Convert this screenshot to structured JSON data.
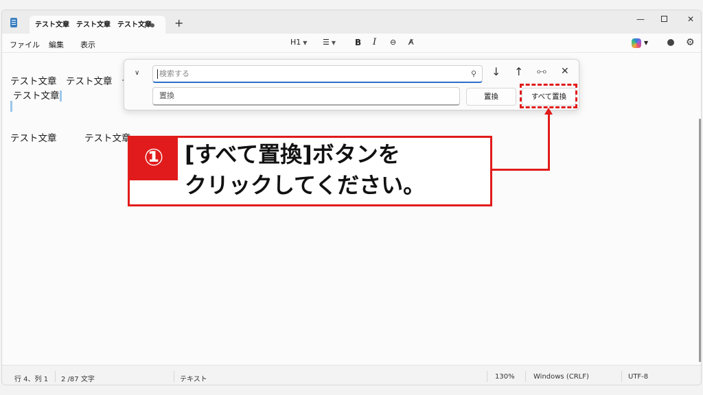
{
  "tab": {
    "title": "テスト文章　テスト文章　テスト文章",
    "menu_glyph": "⋮"
  },
  "titlebar": {
    "new_tab": "+",
    "minimize": "—",
    "close": "✕"
  },
  "menu": {
    "file": "ファイル",
    "edit": "編集",
    "view": "表示"
  },
  "format_toolbar": {
    "heading": "H1",
    "bold": "B",
    "italic": "I"
  },
  "editor": {
    "line1": "テスト文章　テスト文章　テ",
    "line2": "テスト文章",
    "line4": "テスト文章　　　テスト文章"
  },
  "find_panel": {
    "search_placeholder": "検索する",
    "replace_value": "置換",
    "replace_button": "置換",
    "replace_all_button": "すべて置換"
  },
  "callout": {
    "number": "①",
    "line1": "[すべて置換]ボタンを",
    "line2": "クリックしてください。"
  },
  "status": {
    "position": "行 4、列 1",
    "chars": "2 /87 文字",
    "format": "テキスト",
    "zoom": "130%",
    "line_ending": "Windows (CRLF)",
    "encoding": "UTF-8"
  },
  "colors": {
    "accent": "#e11b1b",
    "focus": "#2a6fc9"
  },
  "icons": [
    "notepad-icon",
    "more-icon",
    "unsaved-dot-icon",
    "plus-icon",
    "minimize-icon",
    "maximize-icon",
    "close-icon",
    "list-icon",
    "link-icon",
    "clear-format-icon",
    "copilot-icon",
    "user-icon",
    "gear-icon",
    "chevron-down-icon",
    "search-icon",
    "arrow-down-icon",
    "arrow-up-icon",
    "settings-sliders-icon"
  ]
}
